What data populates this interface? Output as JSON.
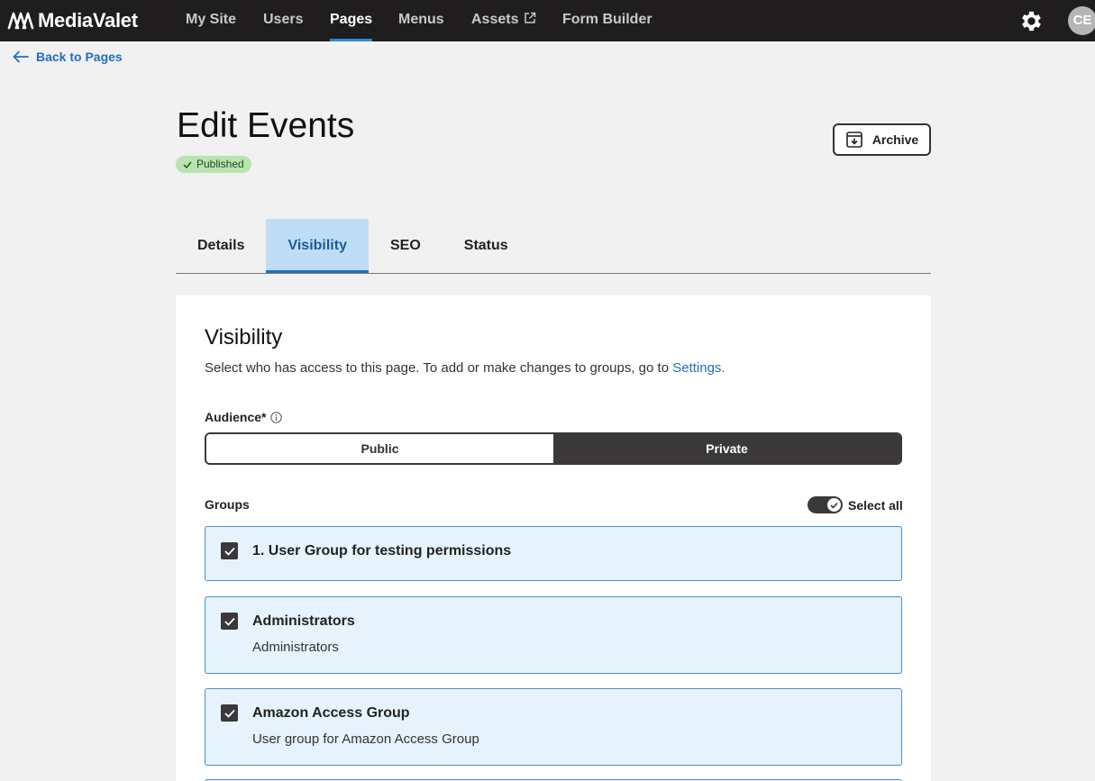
{
  "app": {
    "brand": "MediaValet"
  },
  "nav": {
    "items": [
      {
        "label": "My Site"
      },
      {
        "label": "Users"
      },
      {
        "label": "Pages"
      },
      {
        "label": "Menus"
      },
      {
        "label": "Assets"
      },
      {
        "label": "Form Builder"
      }
    ],
    "active": "Pages",
    "avatar_initials": "CE"
  },
  "back_link": {
    "label": "Back to Pages"
  },
  "header": {
    "title": "Edit Events",
    "status_badge": "Published",
    "archive_label": "Archive"
  },
  "tabs": [
    {
      "label": "Details"
    },
    {
      "label": "Visibility"
    },
    {
      "label": "SEO"
    },
    {
      "label": "Status"
    }
  ],
  "active_tab": "Visibility",
  "visibility": {
    "title": "Visibility",
    "description": "Select who has access to this page. To add or make changes to groups, go to ",
    "settings_link": "Settings.",
    "audience_label": "Audience*",
    "audience_options": [
      "Public",
      "Private"
    ],
    "audience_selected": "Private",
    "groups_label": "Groups",
    "select_all_label": "Select all",
    "select_all_on": true,
    "groups": [
      {
        "name": "1. User Group for testing permissions",
        "description": "",
        "checked": true
      },
      {
        "name": "Administrators",
        "description": "Administrators",
        "checked": true
      },
      {
        "name": "Amazon Access Group",
        "description": "User group for Amazon Access Group",
        "checked": true
      }
    ]
  },
  "colors": {
    "nav_bg": "#1f1d1d",
    "accent": "#1e6fbf",
    "active_tab_bg": "#bfdef6",
    "card_bg": "#e7f3fc",
    "badge_bg": "#b8e4b0",
    "dark": "#3a3838"
  }
}
